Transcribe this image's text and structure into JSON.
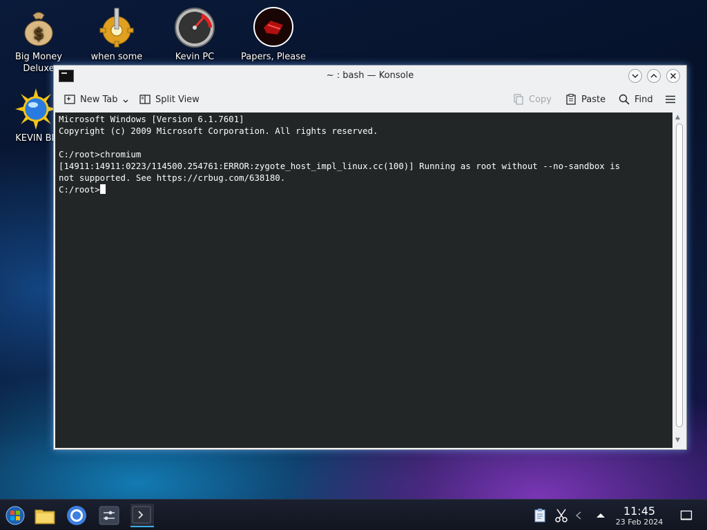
{
  "desktop": {
    "icons": [
      {
        "label": "Big Money Deluxe"
      },
      {
        "label": "when some"
      },
      {
        "label": "Kevin PC"
      },
      {
        "label": "Papers, Please"
      },
      {
        "label": "KEVIN BL"
      }
    ]
  },
  "window": {
    "title": "~ : bash — Konsole",
    "toolbar": {
      "new_tab": "New Tab",
      "split_view": "Split View",
      "copy": "Copy",
      "paste": "Paste",
      "find": "Find"
    },
    "terminal": {
      "lines": [
        "Microsoft Windows [Version 6.1.7601]",
        "Copyright (c) 2009 Microsoft Corporation. All rights reserved.",
        "",
        "C:/root>chromium",
        "[14911:14911:0223/114500.254761:ERROR:zygote_host_impl_linux.cc(100)] Running as root without --no-sandbox is",
        "not supported. See https://crbug.com/638180."
      ],
      "prompt": "C:/root>"
    }
  },
  "taskbar": {
    "time": "11:45",
    "date": "23 Feb 2024"
  }
}
